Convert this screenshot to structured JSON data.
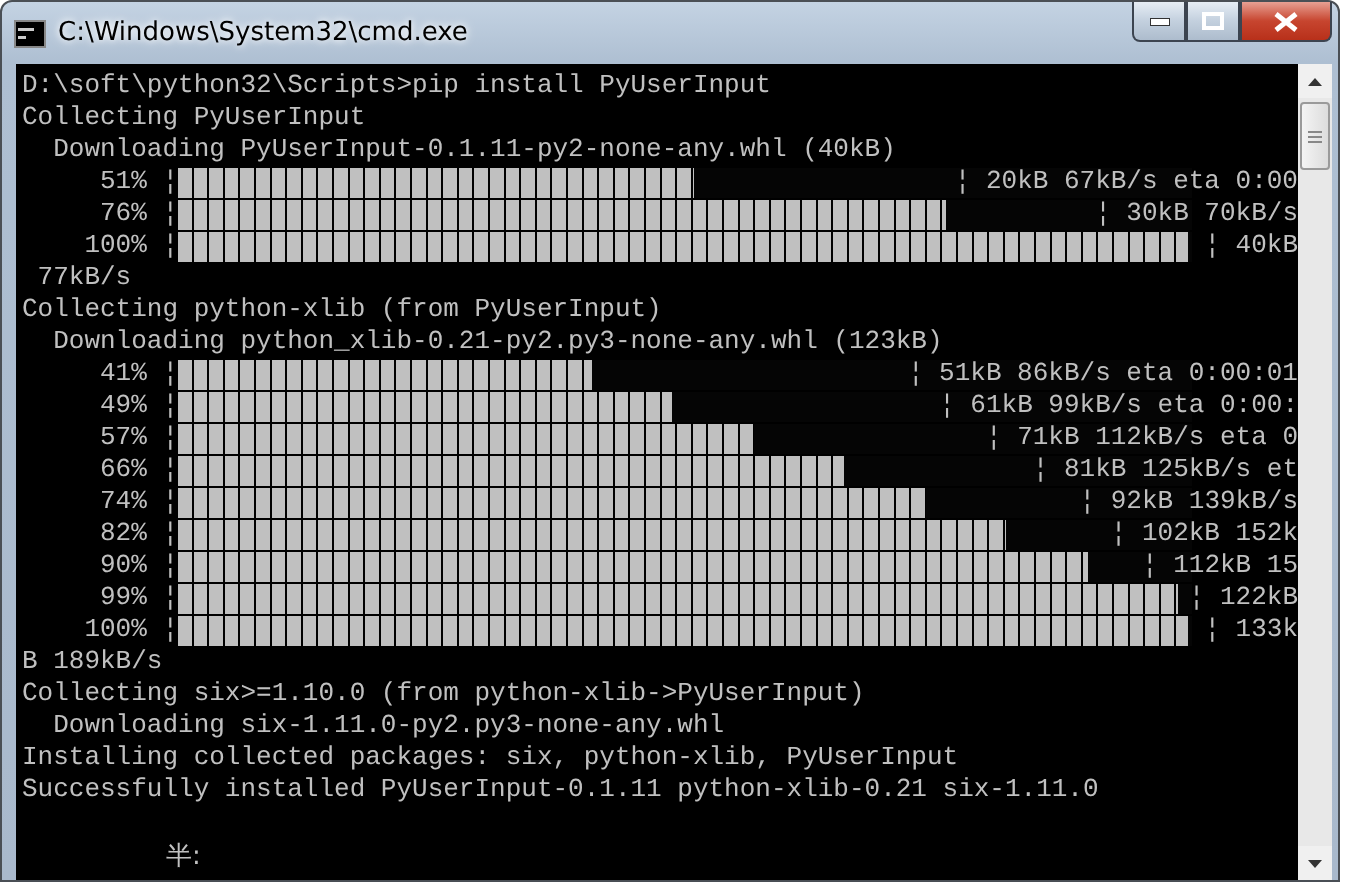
{
  "window": {
    "title": "C:\\Windows\\System32\\cmd.exe"
  },
  "console": {
    "lines": [
      {
        "kind": "text",
        "text": "D:\\soft\\python32\\Scripts>pip install PyUserInput"
      },
      {
        "kind": "text",
        "text": "Collecting PyUserInput"
      },
      {
        "kind": "text",
        "text": "  Downloading PyUserInput-0.1.11-py2-none-any.whl (40kB)"
      },
      {
        "kind": "progress",
        "percent": "51%",
        "open": "¦",
        "level": 0.51,
        "tail": "¦ 20kB 67kB/s eta 0:00"
      },
      {
        "kind": "progress",
        "percent": "76%",
        "open": "¦",
        "level": 0.76,
        "tail": "¦ 30kB 70kB/s"
      },
      {
        "kind": "progress",
        "percent": "100%",
        "open": "¦",
        "level": 1,
        "tail": "¦ 40kB"
      },
      {
        "kind": "text",
        "text": " 77kB/s"
      },
      {
        "kind": "text",
        "text": "Collecting python-xlib (from PyUserInput)"
      },
      {
        "kind": "text",
        "text": "  Downloading python_xlib-0.21-py2.py3-none-any.whl (123kB)"
      },
      {
        "kind": "progress",
        "percent": "41%",
        "open": "¦",
        "level": 0.41,
        "tail": "¦ 51kB 86kB/s eta 0:00:01"
      },
      {
        "kind": "progress",
        "percent": "49%",
        "open": "¦",
        "level": 0.49,
        "tail": "¦ 61kB 99kB/s eta 0:00:"
      },
      {
        "kind": "progress",
        "percent": "57%",
        "open": "¦",
        "level": 0.57,
        "tail": "¦ 71kB 112kB/s eta 0"
      },
      {
        "kind": "progress",
        "percent": "66%",
        "open": "¦",
        "level": 0.66,
        "tail": "¦ 81kB 125kB/s et"
      },
      {
        "kind": "progress",
        "percent": "74%",
        "open": "¦",
        "level": 0.74,
        "tail": "¦ 92kB 139kB/s"
      },
      {
        "kind": "progress",
        "percent": "82%",
        "open": "¦",
        "level": 0.82,
        "tail": "¦ 102kB 152k"
      },
      {
        "kind": "progress",
        "percent": "90%",
        "open": "¦",
        "level": 0.9,
        "tail": "¦ 112kB 15"
      },
      {
        "kind": "progress",
        "percent": "99%",
        "open": "¦",
        "level": 0.99,
        "tail": "¦ 122kB"
      },
      {
        "kind": "progress",
        "percent": "100%",
        "open": "¦",
        "level": 1,
        "tail": "¦ 133k"
      },
      {
        "kind": "text",
        "text": "B 189kB/s"
      },
      {
        "kind": "text",
        "text": "Collecting six>=1.10.0 (from python-xlib->PyUserInput)"
      },
      {
        "kind": "text",
        "text": "  Downloading six-1.11.0-py2.py3-none-any.whl"
      },
      {
        "kind": "text",
        "text": "Installing collected packages: six, python-xlib, PyUserInput"
      },
      {
        "kind": "text",
        "text": "Successfully installed PyUserInput-0.1.11 python-xlib-0.21 six-1.11.0"
      }
    ],
    "ime_status": "半:"
  }
}
